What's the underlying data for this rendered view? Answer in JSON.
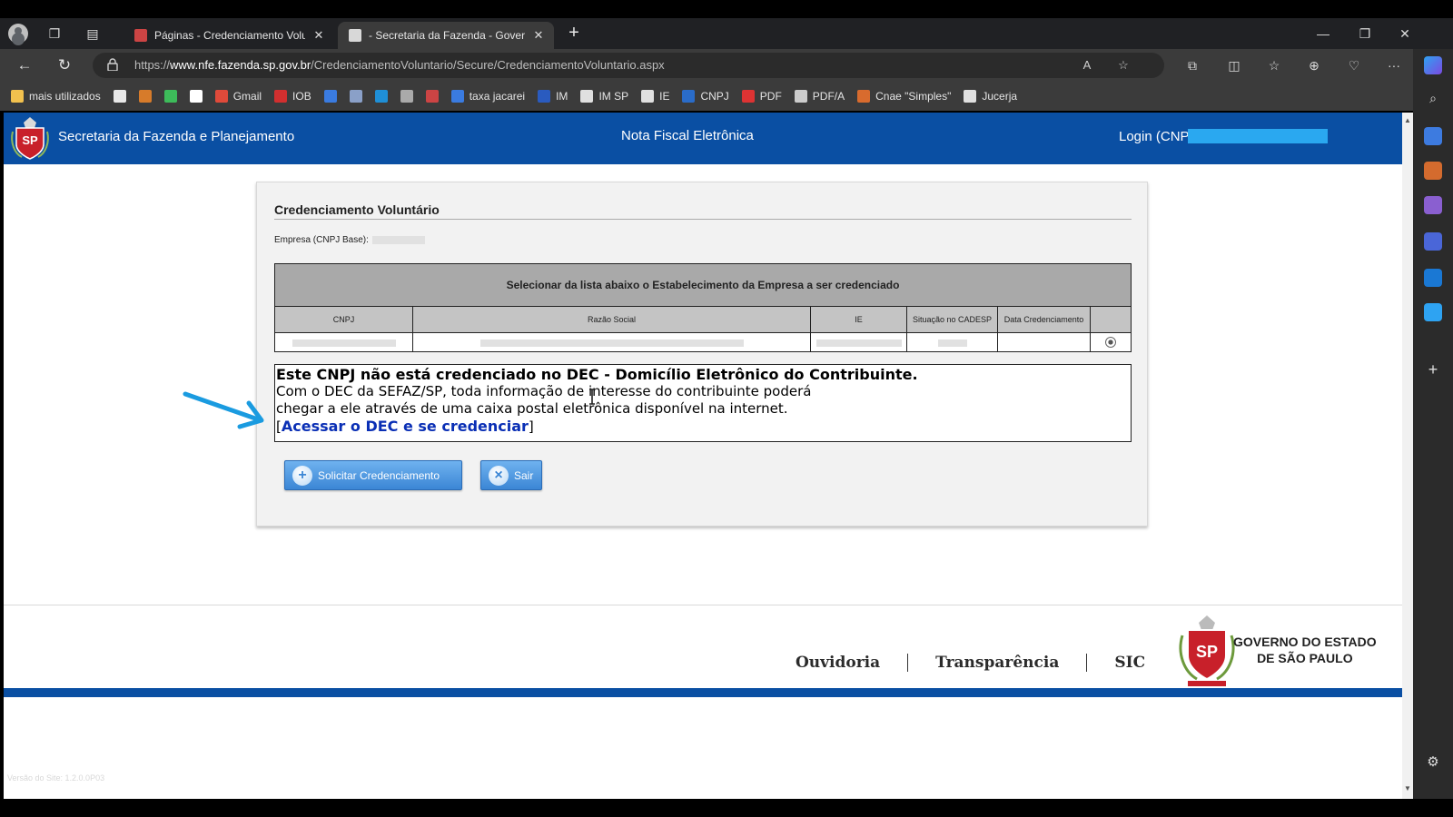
{
  "browser": {
    "tabs": [
      {
        "title": "Páginas - Credenciamento Volunt",
        "active": false
      },
      {
        "title": "- Secretaria da Fazenda - Govern",
        "active": true
      }
    ],
    "url_prefix": "https://",
    "url_host": "www.nfe.fazenda.sp.gov.br",
    "url_path": "/CredenciamentoVoluntario/Secure/CredenciamentoVoluntario.aspx",
    "bookmarks": [
      {
        "label": "mais utilizados",
        "icon": "folder-icon",
        "color": "#f2c14e"
      },
      {
        "label": "",
        "icon": "mail-icon",
        "color": "#e8e8e8"
      },
      {
        "label": "",
        "icon": "circle-icon",
        "color": "#d77b2a"
      },
      {
        "label": "",
        "icon": "whatsapp-icon",
        "color": "#3dbb5a"
      },
      {
        "label": "",
        "icon": "google-icon",
        "color": "#ffffff"
      },
      {
        "label": "Gmail",
        "icon": "gmail-icon",
        "color": "#e04a3a"
      },
      {
        "label": "IOB",
        "icon": "iob-icon",
        "color": "#d22f2f"
      },
      {
        "label": "",
        "icon": "check-icon",
        "color": "#3a7be0"
      },
      {
        "label": "",
        "icon": "coat-icon",
        "color": "#8aa0c8"
      },
      {
        "label": "",
        "icon": "box-icon",
        "color": "#1f8fd6"
      },
      {
        "label": "",
        "icon": "grid-icon",
        "color": "#aaaaaa"
      },
      {
        "label": "",
        "icon": "badge-icon",
        "color": "#c44"
      },
      {
        "label": "taxa jacarei",
        "icon": "globe-icon",
        "color": "#3a7be0"
      },
      {
        "label": "IM",
        "icon": "iss-icon",
        "color": "#2a5bbf"
      },
      {
        "label": "IM SP",
        "icon": "doc-icon",
        "color": "#e0e0e0"
      },
      {
        "label": "IE",
        "icon": "page-icon",
        "color": "#e0e0e0"
      },
      {
        "label": "CNPJ",
        "icon": "cnpj-icon",
        "color": "#2a6cc9"
      },
      {
        "label": "PDF",
        "icon": "pdf-icon",
        "color": "#d33"
      },
      {
        "label": "PDF/A",
        "icon": "pdfa-icon",
        "color": "#cccccc"
      },
      {
        "label": "Cnae \"Simples\"",
        "icon": "cnae-icon",
        "color": "#d86b2e"
      },
      {
        "label": "Jucerja",
        "icon": "page-icon",
        "color": "#e0e0e0"
      }
    ]
  },
  "site": {
    "title": "Secretaria da Fazenda e Planejamento",
    "center": "Nota Fiscal Eletrônica",
    "login_label": "Login (CNPJ):"
  },
  "panel": {
    "title": "Credenciamento Voluntário",
    "empresa_label": "Empresa (CNPJ Base):",
    "table_caption": "Selecionar da lista abaixo o Estabelecimento da Empresa a ser credenciado",
    "columns": [
      "CNPJ",
      "Razão Social",
      "IE",
      "Situação no CADESP",
      "Data Credenciamento",
      ""
    ]
  },
  "notice": {
    "heading": "Este CNPJ não está credenciado no DEC - Domicílio Eletrônico do Contribuinte.",
    "line1": "Com o DEC da SEFAZ/SP, toda informação de interesse do contribuinte poderá",
    "line2": "chegar a ele através de uma caixa postal eletrônica disponível na internet.",
    "link": "Acessar o DEC e se credenciar",
    "bracket_open": "[",
    "bracket_close": "]"
  },
  "buttons": {
    "solicitar": "Solicitar Credenciamento",
    "sair": "Sair"
  },
  "footer": {
    "links": [
      "Ouvidoria",
      "Transparência",
      "SIC"
    ],
    "gov_line1": "GOVERNO DO ESTADO",
    "gov_line2": "DE SÃO PAULO",
    "version": "Versão do Site: 1.2.0.0P03"
  },
  "colors": {
    "header_blue": "#0a4fa3",
    "annotation_arrow": "#1a9be0",
    "link_blue": "#0a2fb5"
  }
}
